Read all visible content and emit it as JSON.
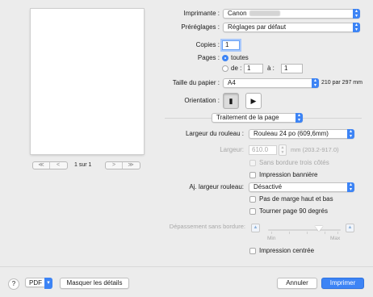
{
  "preview": {
    "page_indicator": "1 sur 1"
  },
  "printer": {
    "label": "Imprimante :",
    "value": "Canon"
  },
  "presets": {
    "label": "Préréglages :",
    "value": "Réglages par défaut"
  },
  "copies": {
    "label": "Copies :",
    "value": "1"
  },
  "pages": {
    "label": "Pages :",
    "all": "toutes",
    "from_label": "de :",
    "from_value": "1",
    "to_label": "à :",
    "to_value": "1"
  },
  "paper": {
    "label": "Taille du papier :",
    "value": "A4",
    "dims": "210 par 297 mm"
  },
  "orientation": {
    "label": "Orientation :"
  },
  "section": {
    "value": "Traitement de la page"
  },
  "roll_width": {
    "label": "Largeur du rouleau :",
    "value": "Rouleau 24 po (609,6mm)"
  },
  "width": {
    "label": "Largeur:",
    "value": "610.0",
    "unit": "mm (203.2-917.0)"
  },
  "borderless_3": {
    "label": "Sans bordure trois côtés"
  },
  "banner": {
    "label": "Impression bannière"
  },
  "fit_roll": {
    "label": "Aj. largeur rouleau:",
    "value": "Désactivé"
  },
  "no_margin": {
    "label": "Pas de marge haut et bas"
  },
  "rotate": {
    "label": "Tourner page 90 degrés"
  },
  "overflow": {
    "label": "Dépassement sans bordure:",
    "min": "Min",
    "max": "Max",
    "level": 0.7
  },
  "centered": {
    "label": "Impression centrée"
  },
  "footer": {
    "help": "?",
    "pdf": "PDF",
    "details": "Masquer les détails",
    "cancel": "Annuler",
    "print": "Imprimer"
  },
  "glyphs": {
    "first": "≪",
    "prev": "<",
    "next": ">",
    "last": "≫",
    "up": "▲",
    "down": "▼",
    "chevron": "⌃"
  }
}
